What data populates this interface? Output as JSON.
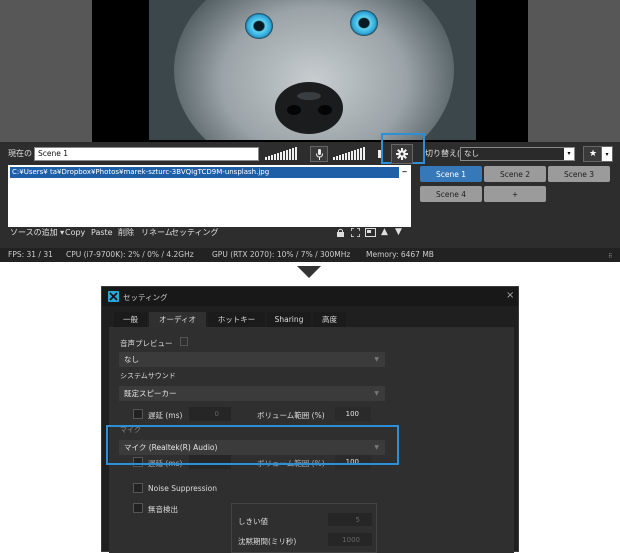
{
  "main": {
    "current_label": "現在の",
    "current_scene": "Scene 1",
    "switch_label": "切り替え(I)",
    "switch_value": "なし",
    "source_path": "C:¥Users¥    ta¥Dropbox¥Photos¥marek-szturc-3BVQIgTCD9M-unsplash.jpg",
    "scenes": [
      "Scene 1",
      "Scene 2",
      "Scene 3",
      "Scene 4",
      "+"
    ],
    "toolbar": {
      "add_source": "ソースの追加",
      "copy": "Copy",
      "paste": "Paste",
      "delete": "削除",
      "rename": "リネーム",
      "settings": "セッティング"
    },
    "status": {
      "fps": "FPS:  31 / 31",
      "cpu": "CPU (i7-9700K):  2% / 0% / 4.2GHz",
      "gpu": "GPU (RTX 2070):  10% / 7% / 300MHz",
      "memory": "Memory:  6467 MB"
    }
  },
  "settings": {
    "title": "セッティング",
    "close": "×",
    "tabs": [
      "一般",
      "オーディオ",
      "ホットキー",
      "Sharing",
      "高度"
    ],
    "active_tab": "オーディオ",
    "audio_preview_label": "音声プレビュー",
    "audio_preview_value": "なし",
    "system_sound_label": "システムサウンド",
    "system_sound_value": "既定スピーカー",
    "delay_label": "遅延 (ms)",
    "delay_value": "0",
    "volume_range_label": "ボリューム範囲 (%)",
    "volume_value": "100",
    "mic_label": "マイク",
    "mic_value": "マイク (Realtek(R) Audio)",
    "mic_delay_label": "遅延 (ms)",
    "mic_volume_label": "ボリューム範囲 (%)",
    "mic_volume_value": "100",
    "noise_suppression_label": "Noise Suppression",
    "silence_detect_label": "無音検出",
    "threshold_label": "しきい値",
    "threshold_value": "5",
    "silence_duration_label": "沈黙期間(ミリ秒)",
    "silence_duration_value": "1000"
  },
  "colors": {
    "highlight": "#2f8fd6",
    "active_scene": "#3778b8",
    "source_selected": "#1e5fa8"
  }
}
